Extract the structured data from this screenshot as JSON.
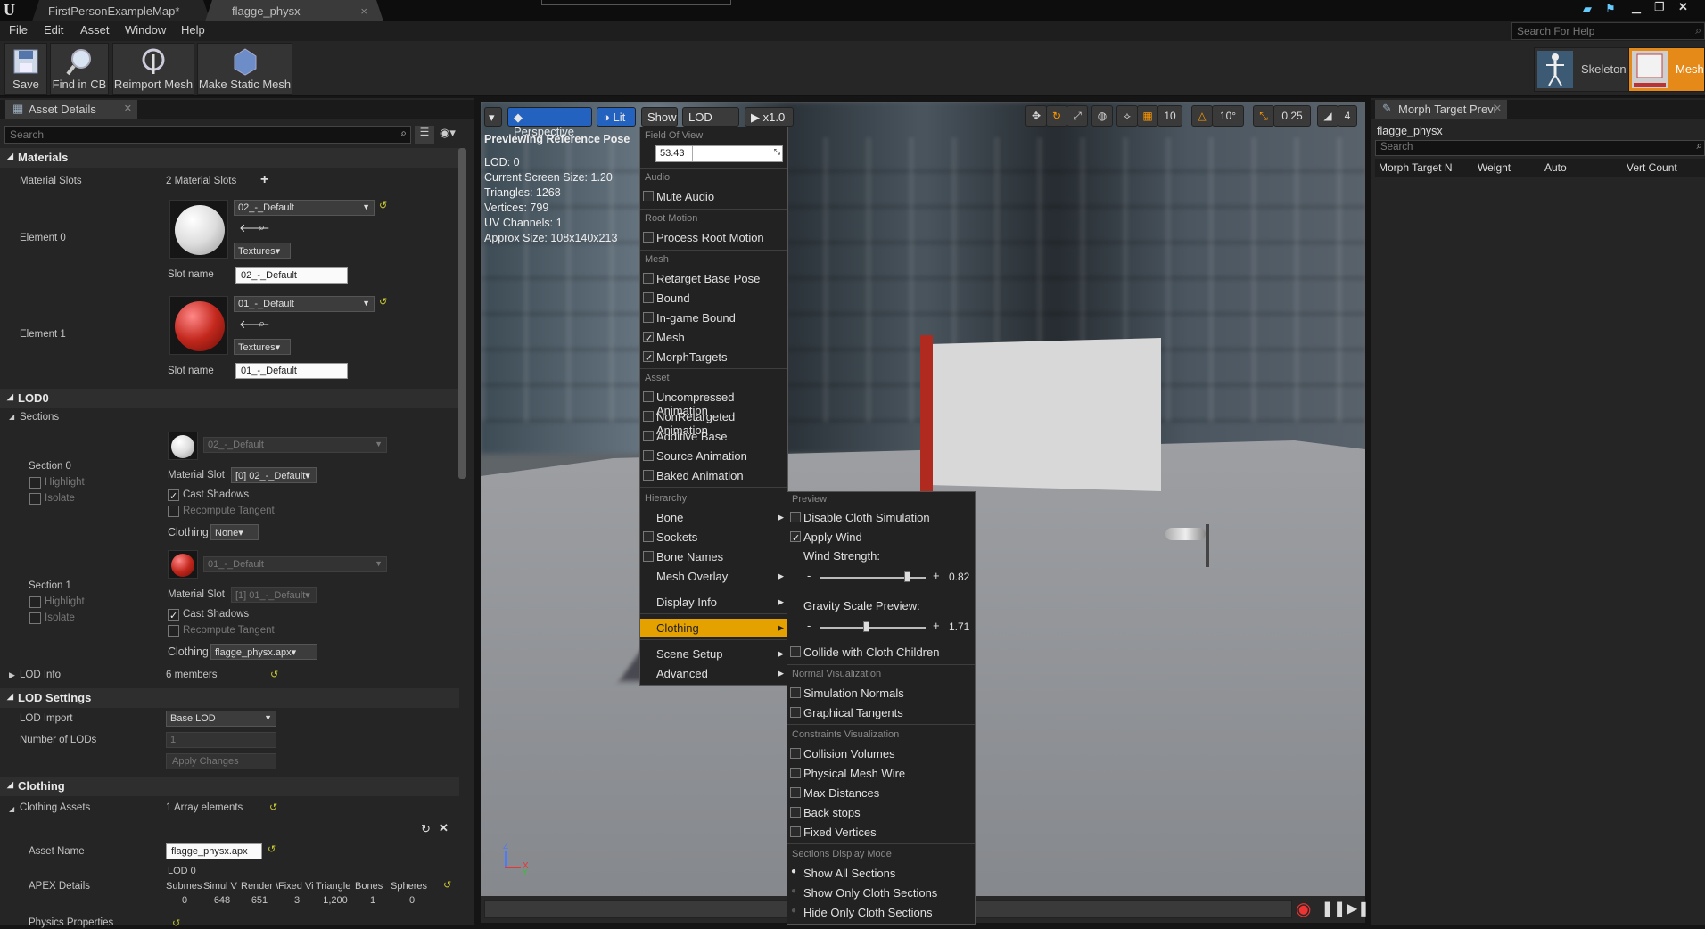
{
  "titlebar": {
    "tabs": [
      "FirstPersonExampleMap*",
      "flagge_physx"
    ]
  },
  "menubar": {
    "items": [
      "File",
      "Edit",
      "Asset",
      "Window",
      "Help"
    ],
    "search_placeholder": "Search For Help"
  },
  "toolbar": {
    "buttons": [
      "Save",
      "Find in CB",
      "Reimport Mesh",
      "Make Static Mesh"
    ],
    "modes": [
      "Skeleton",
      "Mesh"
    ]
  },
  "asset_details": {
    "tab": "Asset Details",
    "search_placeholder": "Search",
    "materials": {
      "header": "Materials",
      "slots_label": "Material Slots",
      "slots_value": "2 Material Slots",
      "elements": [
        {
          "label": "Element 0",
          "material": "02_-_Default",
          "textures": "Textures",
          "slot_name_label": "Slot name",
          "slot_name": "02_-_Default"
        },
        {
          "label": "Element 1",
          "material": "01_-_Default",
          "textures": "Textures",
          "slot_name_label": "Slot name",
          "slot_name": "01_-_Default"
        }
      ]
    },
    "lod0": {
      "header": "LOD0",
      "sections_label": "Sections",
      "sections": [
        {
          "label": "Section 0",
          "highlight": "Highlight",
          "isolate": "Isolate",
          "material": "02_-_Default",
          "material_slot_label": "Material Slot",
          "material_slot": "[0] 02_-_Default",
          "cast_shadows": "Cast Shadows",
          "recompute": "Recompute Tangent",
          "clothing_label": "Clothing",
          "clothing": "None"
        },
        {
          "label": "Section 1",
          "highlight": "Highlight",
          "isolate": "Isolate",
          "material": "01_-_Default",
          "material_slot_label": "Material Slot",
          "material_slot": "[1] 01_-_Default",
          "cast_shadows": "Cast Shadows",
          "recompute": "Recompute Tangent",
          "clothing_label": "Clothing",
          "clothing": "flagge_physx.apx"
        }
      ],
      "lod_info_label": "LOD Info",
      "lod_info_value": "6 members"
    },
    "lod_settings": {
      "header": "LOD Settings",
      "lod_import_label": "LOD Import",
      "lod_import": "Base LOD",
      "num_lods_label": "Number of LODs",
      "num_lods": "1",
      "apply": "Apply Changes"
    },
    "clothing": {
      "header": "Clothing",
      "assets_label": "Clothing Assets",
      "assets_value": "1 Array elements",
      "asset_name_label": "Asset Name",
      "asset_name": "flagge_physx.apx",
      "apex_label": "APEX Details",
      "apex_lod": "LOD 0",
      "apex_cols": [
        "Submes",
        "Simul V",
        "Render \\",
        "Fixed Vi",
        "Triangle",
        "Bones",
        "Spheres"
      ],
      "apex_vals": [
        "0",
        "648",
        "651",
        "3",
        "1,200",
        "1",
        "0"
      ],
      "physics_label": "Physics Properties"
    }
  },
  "viewport": {
    "buttons": [
      "Perspective",
      "Lit",
      "Show",
      "LOD Auto",
      "x1.0"
    ],
    "right_icons": [
      "10",
      "10°",
      "0.25",
      "4"
    ],
    "info": [
      "Previewing Reference Pose",
      "LOD: 0",
      "Current Screen Size: 1.20",
      "Triangles: 1268",
      "Vertices: 799",
      "UV Channels: 1",
      "Approx Size: 108x140x213"
    ]
  },
  "show_menu": {
    "fov_label": "Field Of View",
    "fov": "53.43",
    "sections": [
      {
        "title": "Audio",
        "items": [
          {
            "label": "Mute Audio",
            "checked": false
          }
        ]
      },
      {
        "title": "Root Motion",
        "items": [
          {
            "label": "Process Root Motion",
            "checked": false
          }
        ]
      },
      {
        "title": "Mesh",
        "items": [
          {
            "label": "Retarget Base Pose",
            "checked": false
          },
          {
            "label": "Bound",
            "checked": false
          },
          {
            "label": "In-game Bound",
            "checked": false
          },
          {
            "label": "Mesh",
            "checked": true
          },
          {
            "label": "MorphTargets",
            "checked": true
          }
        ]
      },
      {
        "title": "Asset",
        "items": [
          {
            "label": "Uncompressed Animation",
            "checked": false
          },
          {
            "label": "NonRetargeted Animation",
            "checked": false
          },
          {
            "label": "Additive Base",
            "checked": false
          },
          {
            "label": "Source Animation",
            "checked": false
          },
          {
            "label": "Baked Animation",
            "checked": false
          }
        ]
      }
    ],
    "hierarchy_title": "Hierarchy",
    "bone": "Bone",
    "sockets": "Sockets",
    "bone_names": "Bone Names",
    "mesh_overlay": "Mesh Overlay",
    "display_info": "Display Info",
    "clothing": "Clothing",
    "scene_setup": "Scene Setup",
    "advanced": "Advanced"
  },
  "cloth_menu": {
    "preview_title": "Preview",
    "disable_cloth": "Disable Cloth Simulation",
    "apply_wind": "Apply Wind",
    "wind_label": "Wind Strength:",
    "wind_value": "0.82",
    "wind_level": 0.82,
    "gravity_label": "Gravity Scale Preview:",
    "gravity_value": "1.71",
    "gravity_level": 0.43,
    "collide": "Collide with Cloth Children",
    "normal_title": "Normal Visualization",
    "sim_normals": "Simulation Normals",
    "graph_tangents": "Graphical Tangents",
    "constraints_title": "Constraints Visualization",
    "collision": "Collision Volumes",
    "phys_wire": "Physical Mesh Wire",
    "max_dist": "Max Distances",
    "back_stops": "Back stops",
    "fixed_verts": "Fixed Vertices",
    "sections_title": "Sections Display Mode",
    "show_all": "Show All Sections",
    "show_only": "Show Only Cloth Sections",
    "hide_only": "Hide Only Cloth Sections",
    "minus": "-",
    "plus": "+"
  },
  "morph": {
    "tab": "Morph Target Previ",
    "asset": "flagge_physx",
    "search_placeholder": "Search",
    "cols": [
      "Morph Target N",
      "Weight",
      "Auto",
      "Vert Count"
    ]
  }
}
